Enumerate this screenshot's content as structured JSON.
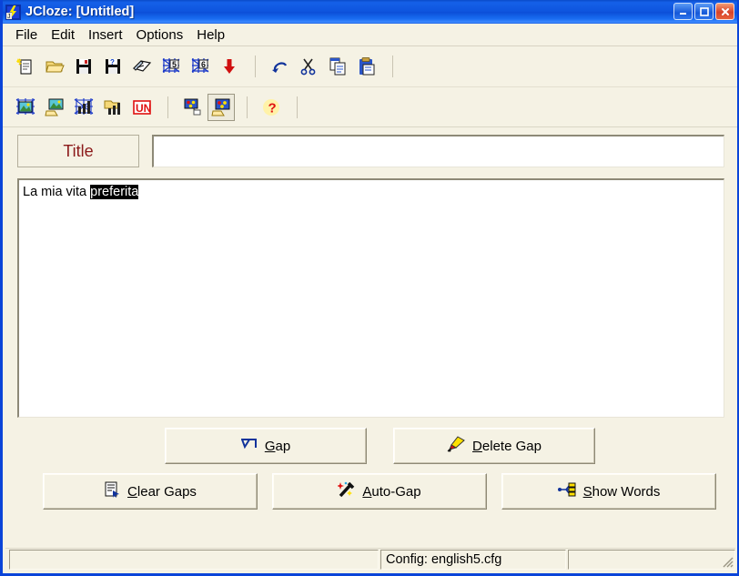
{
  "window": {
    "title": "JCloze: [Untitled]",
    "app_icon": "lightning-bolt-icon",
    "controls": {
      "minimize": "–",
      "maximize": "□",
      "close": "✕"
    },
    "accent_color": "#0E55DE",
    "face_color": "#F5F2E4"
  },
  "menubar": {
    "items": [
      {
        "label": "File"
      },
      {
        "label": "Edit"
      },
      {
        "label": "Insert"
      },
      {
        "label": "Options"
      },
      {
        "label": "Help"
      }
    ]
  },
  "toolbar_row1": {
    "buttons": [
      {
        "name": "new-document-icon",
        "tooltip": "New"
      },
      {
        "name": "open-folder-icon",
        "tooltip": "Open"
      },
      {
        "name": "save-floppy-icon",
        "tooltip": "Save"
      },
      {
        "name": "save-as-floppy-icon",
        "tooltip": "Save As"
      },
      {
        "name": "book-icon",
        "tooltip": "Export"
      },
      {
        "name": "web-page-5-icon",
        "tooltip": "Create Web Page (v5)"
      },
      {
        "name": "web-page-6-icon",
        "tooltip": "Create Web Page (v6)"
      },
      {
        "name": "red-down-arrow-icon",
        "tooltip": "Download"
      },
      {
        "name": "undo-icon",
        "tooltip": "Undo"
      },
      {
        "name": "cut-scissors-icon",
        "tooltip": "Cut"
      },
      {
        "name": "copy-icon",
        "tooltip": "Copy"
      },
      {
        "name": "paste-clipboard-icon",
        "tooltip": "Paste"
      }
    ]
  },
  "toolbar_row2": {
    "buttons": [
      {
        "name": "web-picture-icon",
        "tooltip": "Insert Web Picture"
      },
      {
        "name": "local-picture-icon",
        "tooltip": "Insert Local Picture"
      },
      {
        "name": "web-media-icon",
        "tooltip": "Insert Web Media"
      },
      {
        "name": "local-media-icon",
        "tooltip": "Insert Local Media"
      },
      {
        "name": "unicode-icon",
        "label": "UN",
        "tooltip": "Unicode"
      },
      {
        "name": "web-link-icon",
        "tooltip": "Insert Web Link"
      },
      {
        "name": "local-link-icon",
        "tooltip": "Insert Local Link",
        "pressed": true
      },
      {
        "name": "help-question-icon",
        "label": "?",
        "tooltip": "Help"
      }
    ]
  },
  "title_field": {
    "label": "Title",
    "label_color": "#8B1A1A",
    "value": "",
    "placeholder": ""
  },
  "editor": {
    "text_before": "La mia vita ",
    "selected_text": "preferita",
    "text_after": "",
    "selection_bg": "#000000",
    "selection_fg": "#FFFFFF"
  },
  "actions": {
    "row1": [
      {
        "name": "gap-button",
        "icon": "gap-arrow-icon",
        "accel": "G",
        "pre": "",
        "post": "ap"
      },
      {
        "name": "delete-gap-button",
        "icon": "eraser-icon",
        "accel": "D",
        "pre": "",
        "post": "elete Gap"
      }
    ],
    "row2": [
      {
        "name": "clear-gaps-button",
        "icon": "clear-list-icon",
        "accel": "C",
        "pre": "",
        "post": "lear Gaps"
      },
      {
        "name": "auto-gap-button",
        "icon": "magic-wand-icon",
        "accel": "A",
        "pre": "",
        "post": "uto-Gap"
      },
      {
        "name": "show-words-button",
        "icon": "tree-branch-icon",
        "accel": "S",
        "pre": "",
        "post": "how Words"
      }
    ]
  },
  "statusbar": {
    "panel1": "",
    "panel2": "Config: english5.cfg",
    "panel3": ""
  }
}
